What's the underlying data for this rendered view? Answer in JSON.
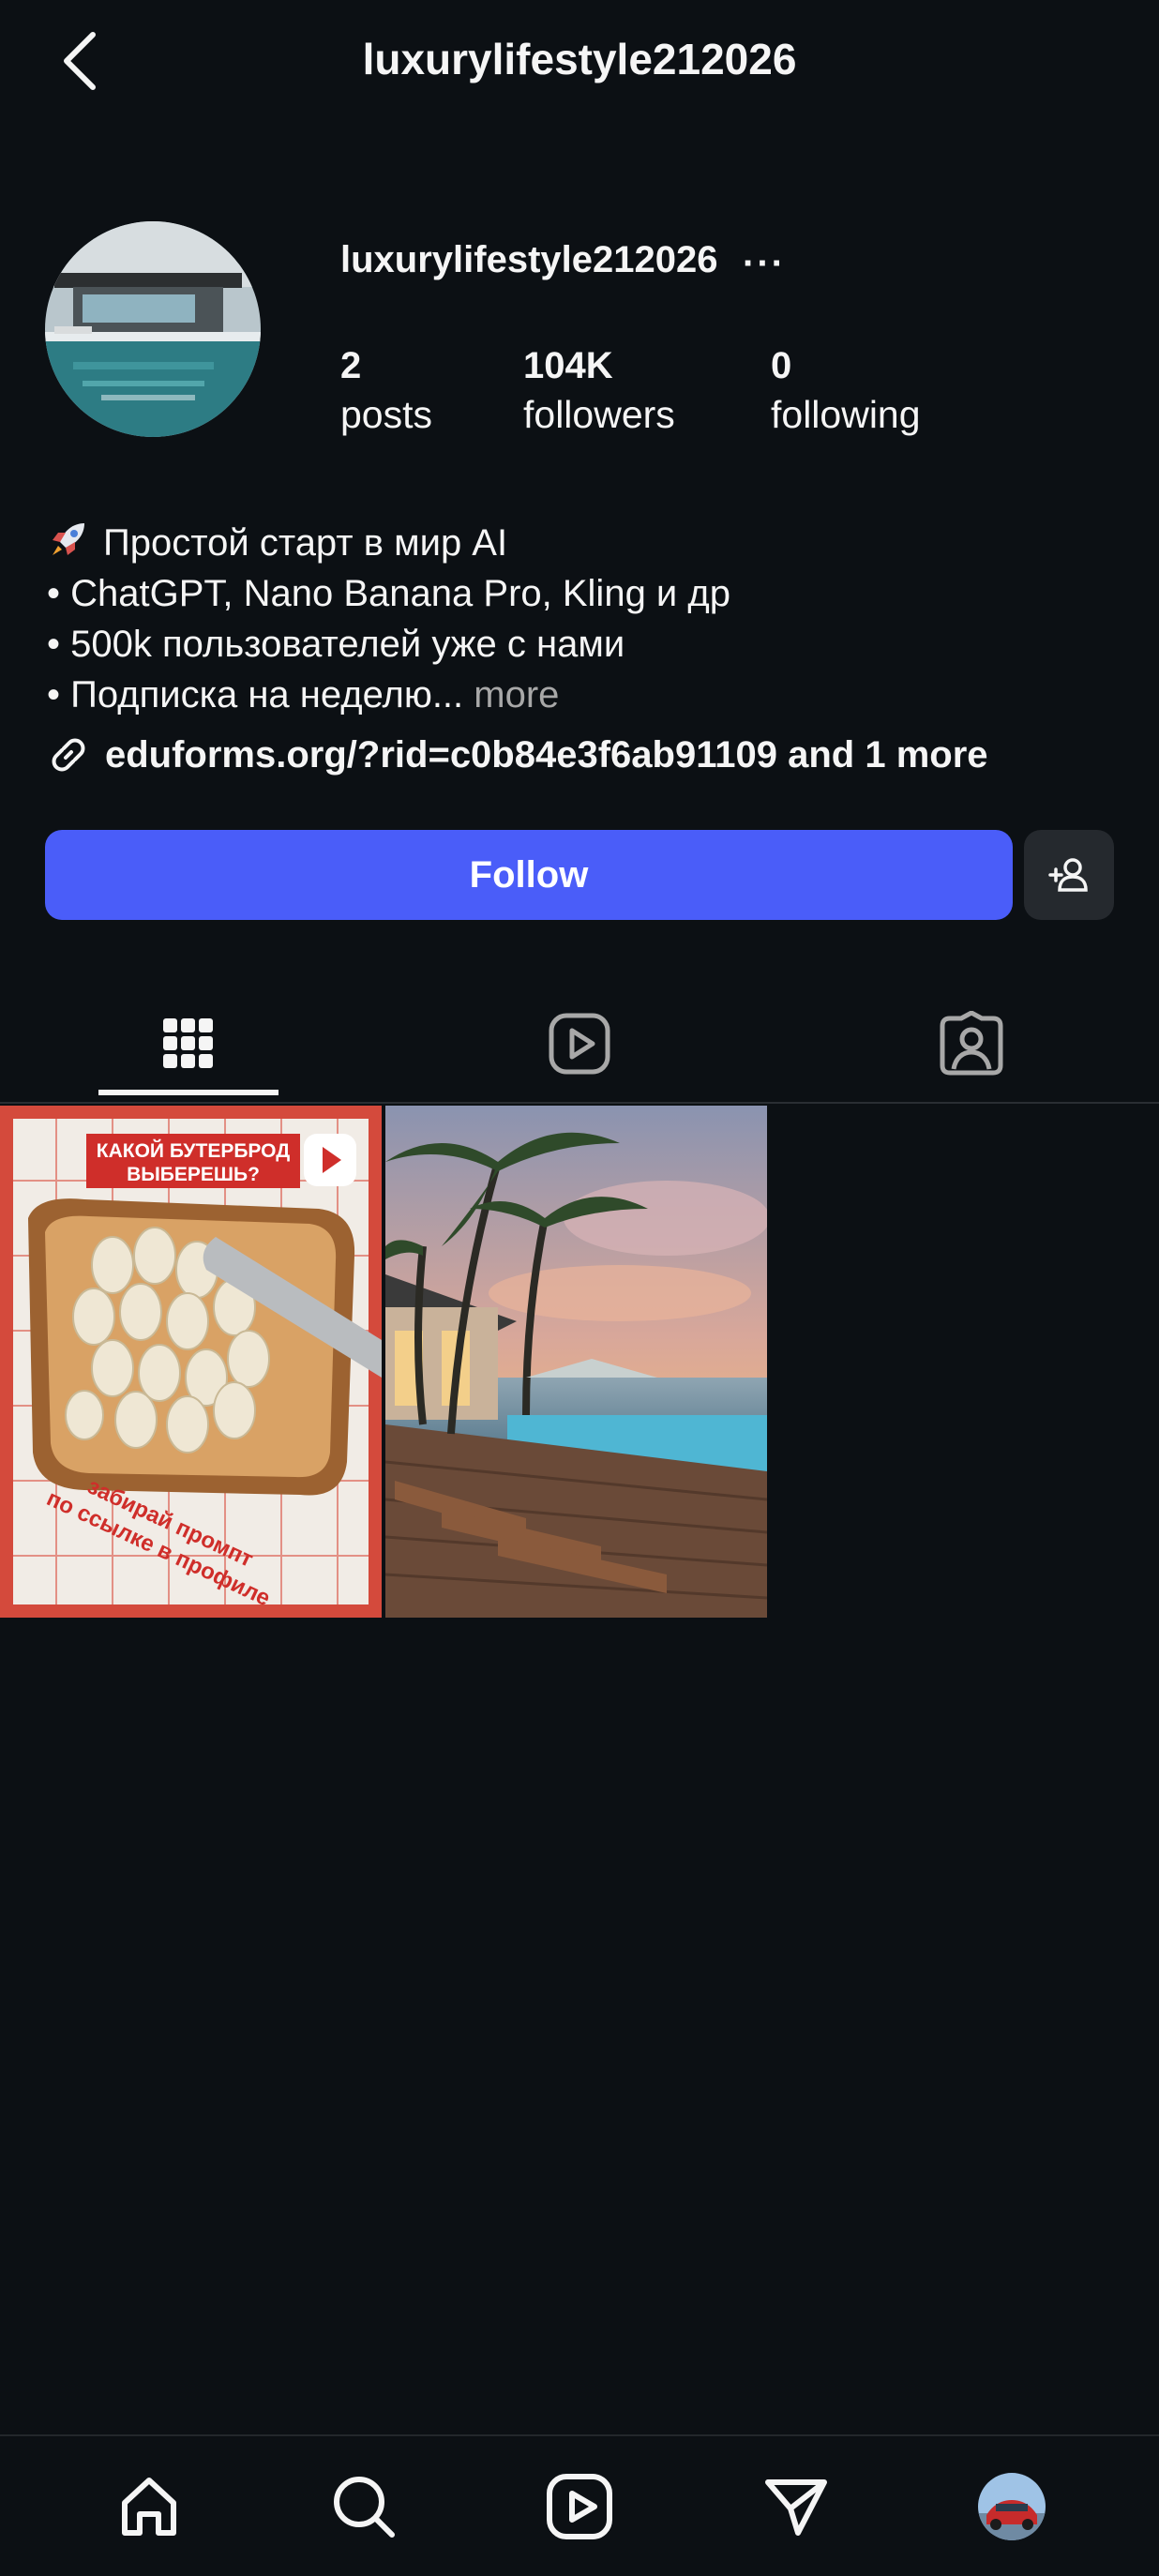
{
  "header": {
    "title": "luxurylifestyle212026",
    "back_icon": "chevron-left-icon"
  },
  "profile": {
    "username": "luxurylifestyle212026",
    "more_label": "···",
    "stats": [
      {
        "value": "2",
        "label": "posts"
      },
      {
        "value": "104K",
        "label": "followers"
      },
      {
        "value": "0",
        "label": "following"
      }
    ]
  },
  "bio": {
    "line1": "Простой старт в мир AI",
    "line2": "• ChatGPT, Nano Banana Pro, Kling и др",
    "line3": "• 500k пользователей уже с нами",
    "line4": "• Подписка на неделю...",
    "more": "more",
    "link": "eduforms.org/?rid=c0b84e3f6ab91109 and 1 more"
  },
  "actions": {
    "follow_label": "Follow",
    "suggest_icon": "add-person-icon"
  },
  "tabs": [
    {
      "name": "posts-grid",
      "icon": "grid-icon",
      "active": true
    },
    {
      "name": "reels",
      "icon": "reels-icon",
      "active": false
    },
    {
      "name": "tagged",
      "icon": "tagged-icon",
      "active": false
    }
  ],
  "posts": [
    {
      "overlay_line1": "КАКОЙ БУТЕРБРОД",
      "overlay_line2": "ВЫБЕРЕШЬ?",
      "caption_line1": "забирай промпт",
      "caption_line2": "по ссылке в профиле",
      "type": "reel"
    },
    {
      "type": "image",
      "subject": "beach-villa"
    }
  ],
  "nav": [
    "home-icon",
    "search-icon",
    "reels-icon",
    "direct-icon",
    "profile-avatar"
  ],
  "colors": {
    "background": "#0c1014",
    "accent": "#4a5df9",
    "secondary_button": "#25292e",
    "muted": "#a8a8a8"
  }
}
